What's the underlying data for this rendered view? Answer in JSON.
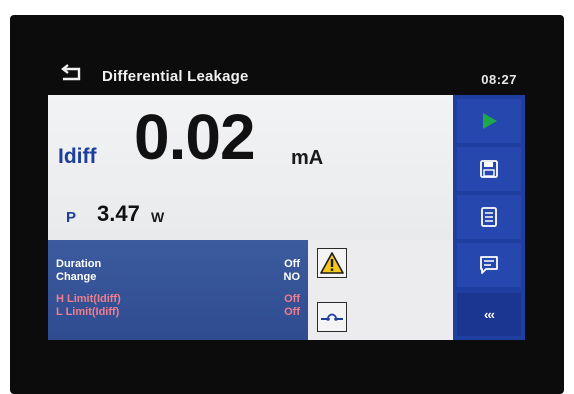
{
  "header": {
    "title": "Differential Leakage",
    "time": "08:27",
    "back_icon": "return-arrow-icon"
  },
  "measurement": {
    "idiff_label": "Idiff",
    "idiff_value": "0.02",
    "idiff_unit": "mA",
    "p_label": "P",
    "p_value": "3.47",
    "p_unit": "W"
  },
  "parameters": [
    {
      "label": "Duration",
      "value": "Off",
      "color": "#ffffff"
    },
    {
      "label": "Change",
      "value": "NO",
      "color": "#ffffff"
    },
    {
      "label": "H Limit(Idiff)",
      "value": "Off",
      "color": "#f27d8c"
    },
    {
      "label": "L Limit(Idiff)",
      "value": "Off",
      "color": "#f27d8c"
    }
  ],
  "status_icons": {
    "warning": "warning-triangle-icon",
    "connection": "open-switch-icon"
  },
  "toolbar": {
    "buttons": [
      {
        "name": "start-button",
        "icon": "play-icon"
      },
      {
        "name": "save-button",
        "icon": "floppy-disk-icon"
      },
      {
        "name": "memory-list-button",
        "icon": "list-icon"
      },
      {
        "name": "comment-button",
        "icon": "comment-icon"
      }
    ],
    "more_label": "‹‹‹"
  },
  "colors": {
    "toolbar_blue": "#1f3fa0",
    "label_blue": "#1d3f9a",
    "param_panel": "#2f4c90",
    "limit_red": "#f27d8c",
    "play_green": "#1fa84a",
    "warning_yellow": "#f3c81a"
  }
}
